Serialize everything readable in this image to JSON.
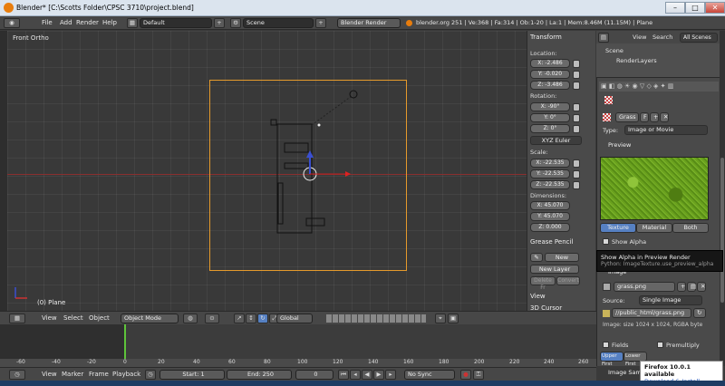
{
  "titlebar": {
    "title": "Blender* [C:\\Scotts Folder\\CPSC 3710\\project.blend]",
    "minimize": "–",
    "maximize": "□",
    "close": "✕"
  },
  "infobar": {
    "menus": [
      "File",
      "Add",
      "Render",
      "Help"
    ],
    "screen_layout": "Default",
    "scene": "Scene",
    "render_engine": "Blender Render",
    "stats": "blender.org 251 | Ve:368 | Fa:314 | Ob:1-20 | La:1 | Mem:8.46M (11.15M) | Plane"
  },
  "viewport": {
    "view_name": "Front Ortho",
    "object_label": "(0) Plane"
  },
  "transform": {
    "title": "Transform",
    "location_label": "Location:",
    "location": [
      "X: -2.486",
      "Y: -0.020",
      "Z: -3.486"
    ],
    "rotation_label": "Rotation:",
    "rotation": [
      "X: -90°",
      "Y: 0°",
      "Z: 0°"
    ],
    "rotation_mode": "XYZ Euler",
    "scale_label": "Scale:",
    "scale": [
      "X: -22.535",
      "Y: -22.535",
      "Z: -22.535"
    ],
    "dimensions_label": "Dimensions:",
    "dimensions": [
      "X: 45.070",
      "Y: 45.070",
      "Z: 0.000"
    ],
    "grease_pencil": "Grease Pencil",
    "new_label": "New",
    "new_layer_label": "New Layer",
    "delete_fr_label": "Delete Fr",
    "convert_label": "Convert",
    "view_section": "View",
    "cursor_section": "3D Cursor"
  },
  "outliner": {
    "view_menu": "View",
    "search_menu": "Search",
    "filter": "All Scenes",
    "scene": "Scene",
    "renderlayers": "RenderLayers"
  },
  "texture": {
    "name": "Grass",
    "users": "F",
    "type_label": "Type:",
    "type_value": "Image or Movie",
    "preview_section": "Preview",
    "tab_texture": "Texture",
    "tab_material": "Material",
    "tab_both": "Both",
    "show_alpha": "Show Alpha",
    "image_section": "Image",
    "image_name": "grass.png",
    "source_label": "Source:",
    "source_value": "Single Image",
    "filepath": "//public_html/grass.png",
    "image_info": "Image: size 1024 x 1024, RGBA byte",
    "fields": "Fields",
    "premultiply": "Premultiply",
    "upper_first": "Upper First",
    "lower_first": "Lower First",
    "image_sampling": "Image Sampling"
  },
  "tooltip": {
    "title": "Show Alpha in Preview Render",
    "python": "Python: ImageTexture.use_preview_alpha"
  },
  "viewport_header": {
    "menus": [
      "View",
      "Select",
      "Object"
    ],
    "mode": "Object Mode",
    "pivot": "Global"
  },
  "timeline": {
    "menus": [
      "View",
      "Marker",
      "Frame",
      "Playback"
    ],
    "start": "Start: 1",
    "end": "End: 250",
    "current": "0",
    "keying": "No Sync",
    "ruler": [
      "-60",
      "-40",
      "-20",
      "0",
      "20",
      "40",
      "60",
      "80",
      "100",
      "120",
      "140",
      "160",
      "180",
      "200",
      "220",
      "240",
      "260"
    ]
  },
  "notify": {
    "title": "Firefox 10.0.1 available",
    "link": "Download & Install..."
  },
  "colors": {
    "selection_orange": "#e59a2c",
    "x_axis_red": "#a52b2b",
    "grass_green": "#6aa11e",
    "active_tab_blue": "#5680c2"
  }
}
